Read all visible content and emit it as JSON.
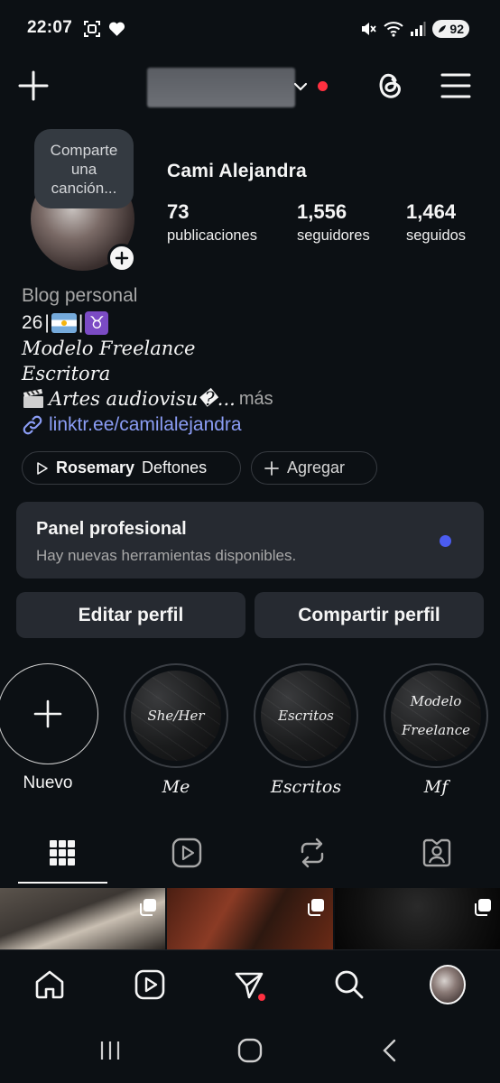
{
  "status_bar": {
    "time": "22:07",
    "battery": "92",
    "icons": [
      "screenshot-icon",
      "heart-icon",
      "mute-icon",
      "wifi-icon",
      "signal-icon",
      "battery-icon"
    ]
  },
  "top_bar": {
    "icons": [
      "create-plus-icon",
      "chevron-down-icon",
      "threads-icon",
      "menu-icon"
    ],
    "notification_color": "#ff3040"
  },
  "profile": {
    "note": "Comparte una canción...",
    "note_lines": [
      "Comparte",
      "una",
      "canción..."
    ],
    "name": "Cami Alejandra",
    "stats": [
      {
        "value": "73",
        "label": "publicaciones"
      },
      {
        "value": "1,556",
        "label": "seguidores"
      },
      {
        "value": "1,464",
        "label": "seguidos"
      }
    ]
  },
  "bio": {
    "category": "Blog personal",
    "age": "26",
    "separator": "|",
    "line2": "Modelo Freelance",
    "line3": "Escritora",
    "line4": "Artes audiovisu�...",
    "more": "más",
    "link": "linktr.ee/camilalejandra"
  },
  "chips": {
    "song_title": "Rosemary",
    "song_artist": "Deftones",
    "add_label": "Agregar"
  },
  "panel": {
    "title": "Panel profesional",
    "subtitle": "Hay nuevas herramientas disponibles.",
    "dot_color": "#4b5cf0"
  },
  "buttons": {
    "edit": "Editar perfil",
    "share": "Compartir perfil"
  },
  "highlights": [
    {
      "label": "Nuevo",
      "cover_text": ""
    },
    {
      "label": "Me",
      "cover_text": "She/Her"
    },
    {
      "label": "Escritos",
      "cover_text": "Escritos"
    },
    {
      "label": "Mf",
      "cover_text": "Modelo Freelance"
    }
  ],
  "highlight_cover_lines": {
    "mf_line1": "Modelo",
    "mf_line2": "Freelance"
  },
  "tabs": [
    "grid-icon",
    "reels-icon",
    "reposts-icon",
    "tagged-icon"
  ],
  "bottom_nav": [
    "home-icon",
    "reels-icon",
    "direct-icon",
    "search-icon",
    "profile-avatar"
  ],
  "system_nav": [
    "recents-icon",
    "home-circle-icon",
    "back-icon"
  ]
}
